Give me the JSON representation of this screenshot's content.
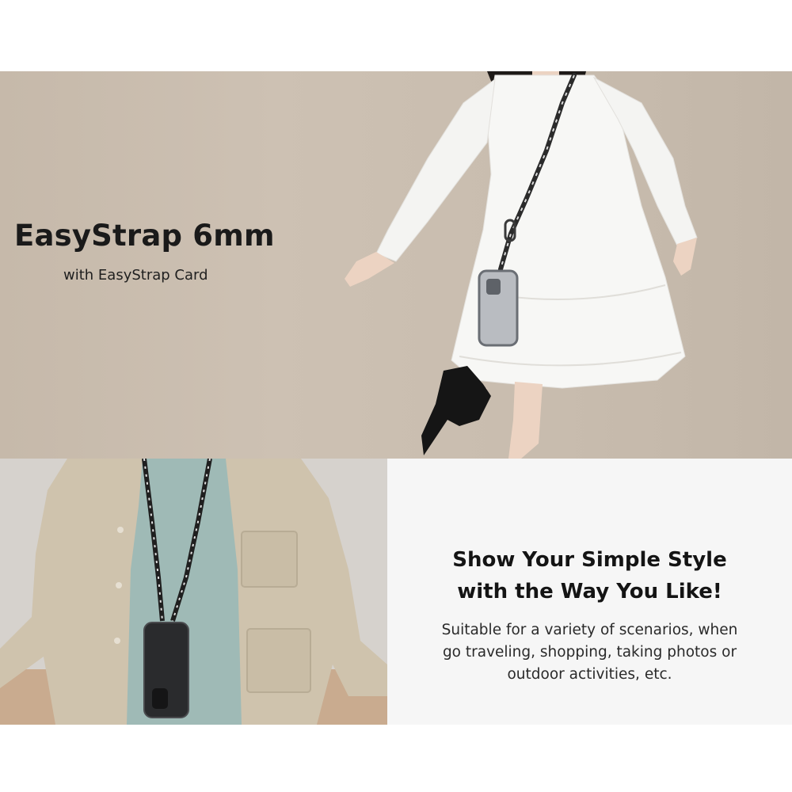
{
  "hero": {
    "title": "EasyStrap 6mm",
    "subtitle": "with EasyStrap Card"
  },
  "feature": {
    "heading_line1": "Show Your Simple Style",
    "heading_line2": "with the Way You Like!",
    "body_line1": "Suitable for a variety of scenarios, when",
    "body_line2": "go traveling, shopping, taking photos or",
    "body_line3": "outdoor activities, etc."
  }
}
